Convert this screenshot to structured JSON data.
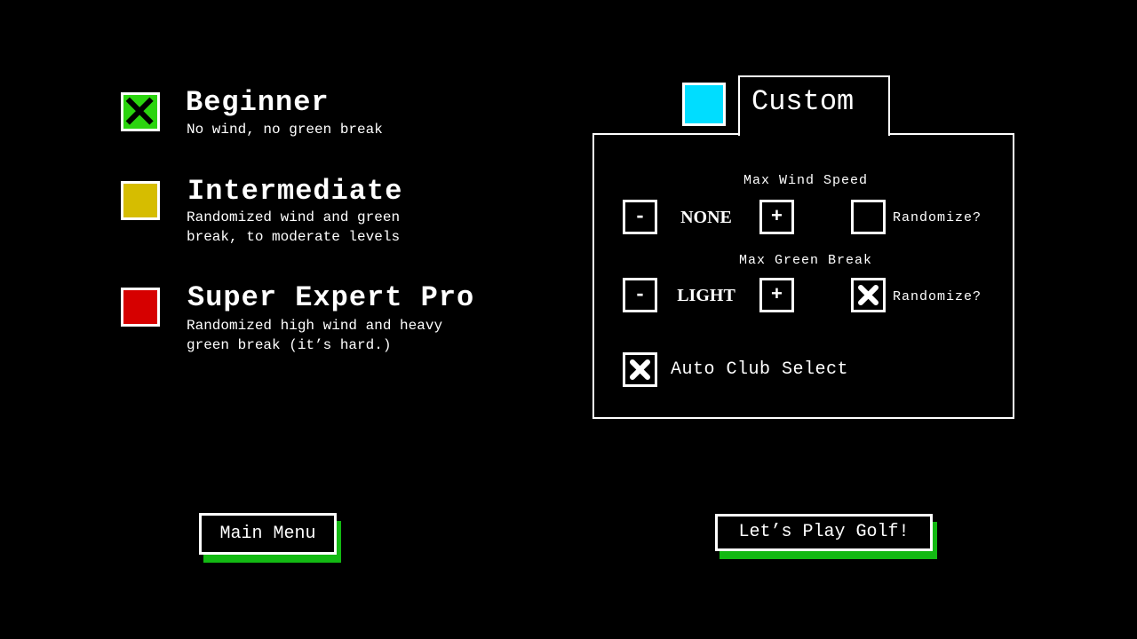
{
  "difficulties": [
    {
      "title": "Beginner",
      "description": "No wind, no green break",
      "color": "#2bd40f",
      "selected": true
    },
    {
      "title": "Intermediate",
      "description": "Randomized wind and green\nbreak, to moderate levels",
      "color": "#d6bd00",
      "selected": false
    },
    {
      "title": "Super Expert Pro",
      "description": "Randomized high wind and heavy\ngreen break (it’s hard.)",
      "color": "#d60000",
      "selected": false
    }
  ],
  "custom": {
    "title": "Custom",
    "color": "#00ddff",
    "selected": false,
    "wind": {
      "label": "Max Wind Speed",
      "value": "NONE",
      "minus": "-",
      "plus": "+",
      "randomize_label": "Randomize?",
      "randomize": false
    },
    "green": {
      "label": "Max Green Break",
      "value": "LIGHT",
      "minus": "-",
      "plus": "+",
      "randomize_label": "Randomize?",
      "randomize": true
    },
    "auto_club": {
      "label": "Auto Club Select",
      "checked": true
    }
  },
  "buttons": {
    "main_menu": "Main Menu",
    "play": "Let’s Play Golf!",
    "shadow_color": "#13b913"
  }
}
